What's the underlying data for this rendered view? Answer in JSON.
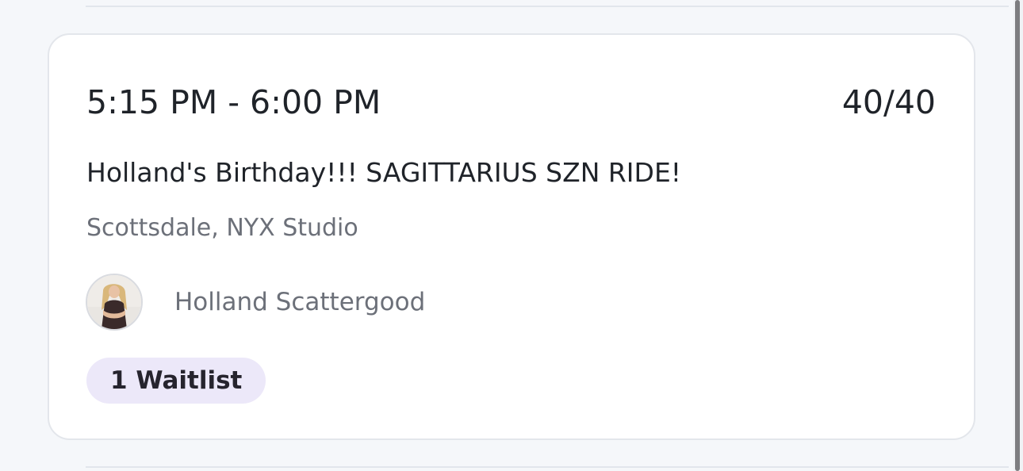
{
  "card": {
    "time_range": "5:15 PM - 6:00 PM",
    "capacity": "40/40",
    "class_title": "Holland's Birthday!!! SAGITTARIUS SZN RIDE!",
    "location": "Scottsdale, NYX Studio",
    "instructor_name": "Holland Scattergood",
    "instructor_avatar_icon": "avatar-photo",
    "waitlist_badge": "1 Waitlist"
  },
  "colors": {
    "page_background": "#f5f7fa",
    "card_background": "#ffffff",
    "primary_text": "#1f2329",
    "secondary_text": "#6c7079",
    "badge_background": "#ece8f9"
  }
}
